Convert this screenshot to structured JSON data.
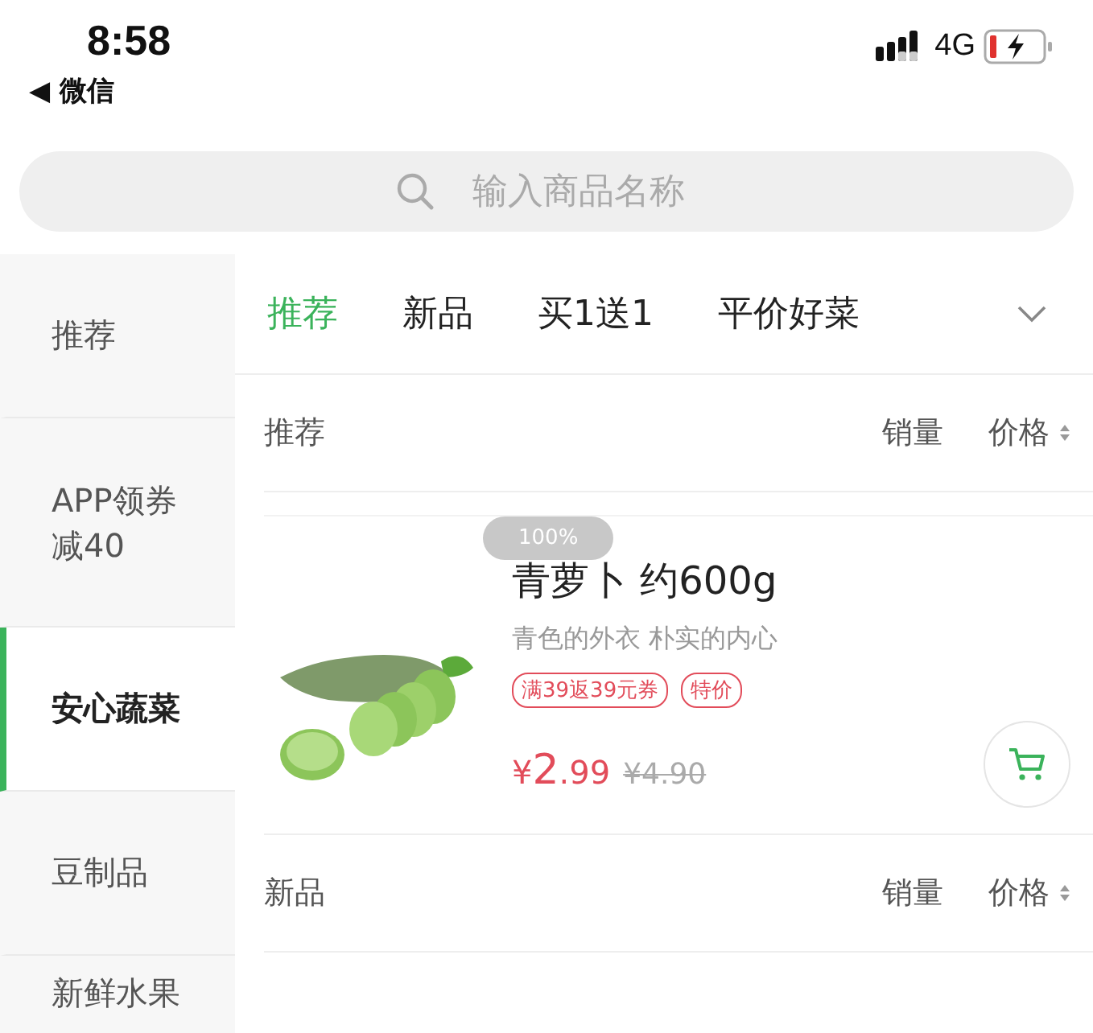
{
  "status_bar": {
    "time": "8:58",
    "back_app": "◀ 微信",
    "network": "4G"
  },
  "search": {
    "placeholder": "输入商品名称"
  },
  "sidebar": {
    "items": [
      {
        "label": "推荐",
        "selected": false
      },
      {
        "label": "APP领券减40",
        "selected": false
      },
      {
        "label": "安心蔬菜",
        "selected": true
      },
      {
        "label": "豆制品",
        "selected": false
      },
      {
        "label": "新鲜水果",
        "selected": false
      }
    ]
  },
  "tabs": [
    {
      "label": "推荐",
      "selected": true
    },
    {
      "label": "新品",
      "selected": false
    },
    {
      "label": "买1送1",
      "selected": false
    },
    {
      "label": "平价好菜",
      "selected": false
    }
  ],
  "sections": [
    {
      "title": "推荐",
      "sort_sales": "销量",
      "sort_price": "价格",
      "products": [
        {
          "name": "青萝卜 约600g",
          "subtitle": "青色的外衣 朴实的内心",
          "tags": [
            "满39返39元券",
            "特价"
          ],
          "price_symbol": "¥",
          "price_int": "2",
          "price_dec": ".99",
          "original_price": "¥4.90"
        }
      ]
    },
    {
      "title": "新品",
      "sort_sales": "销量",
      "sort_price": "价格"
    }
  ],
  "zoom_badge": "100%"
}
